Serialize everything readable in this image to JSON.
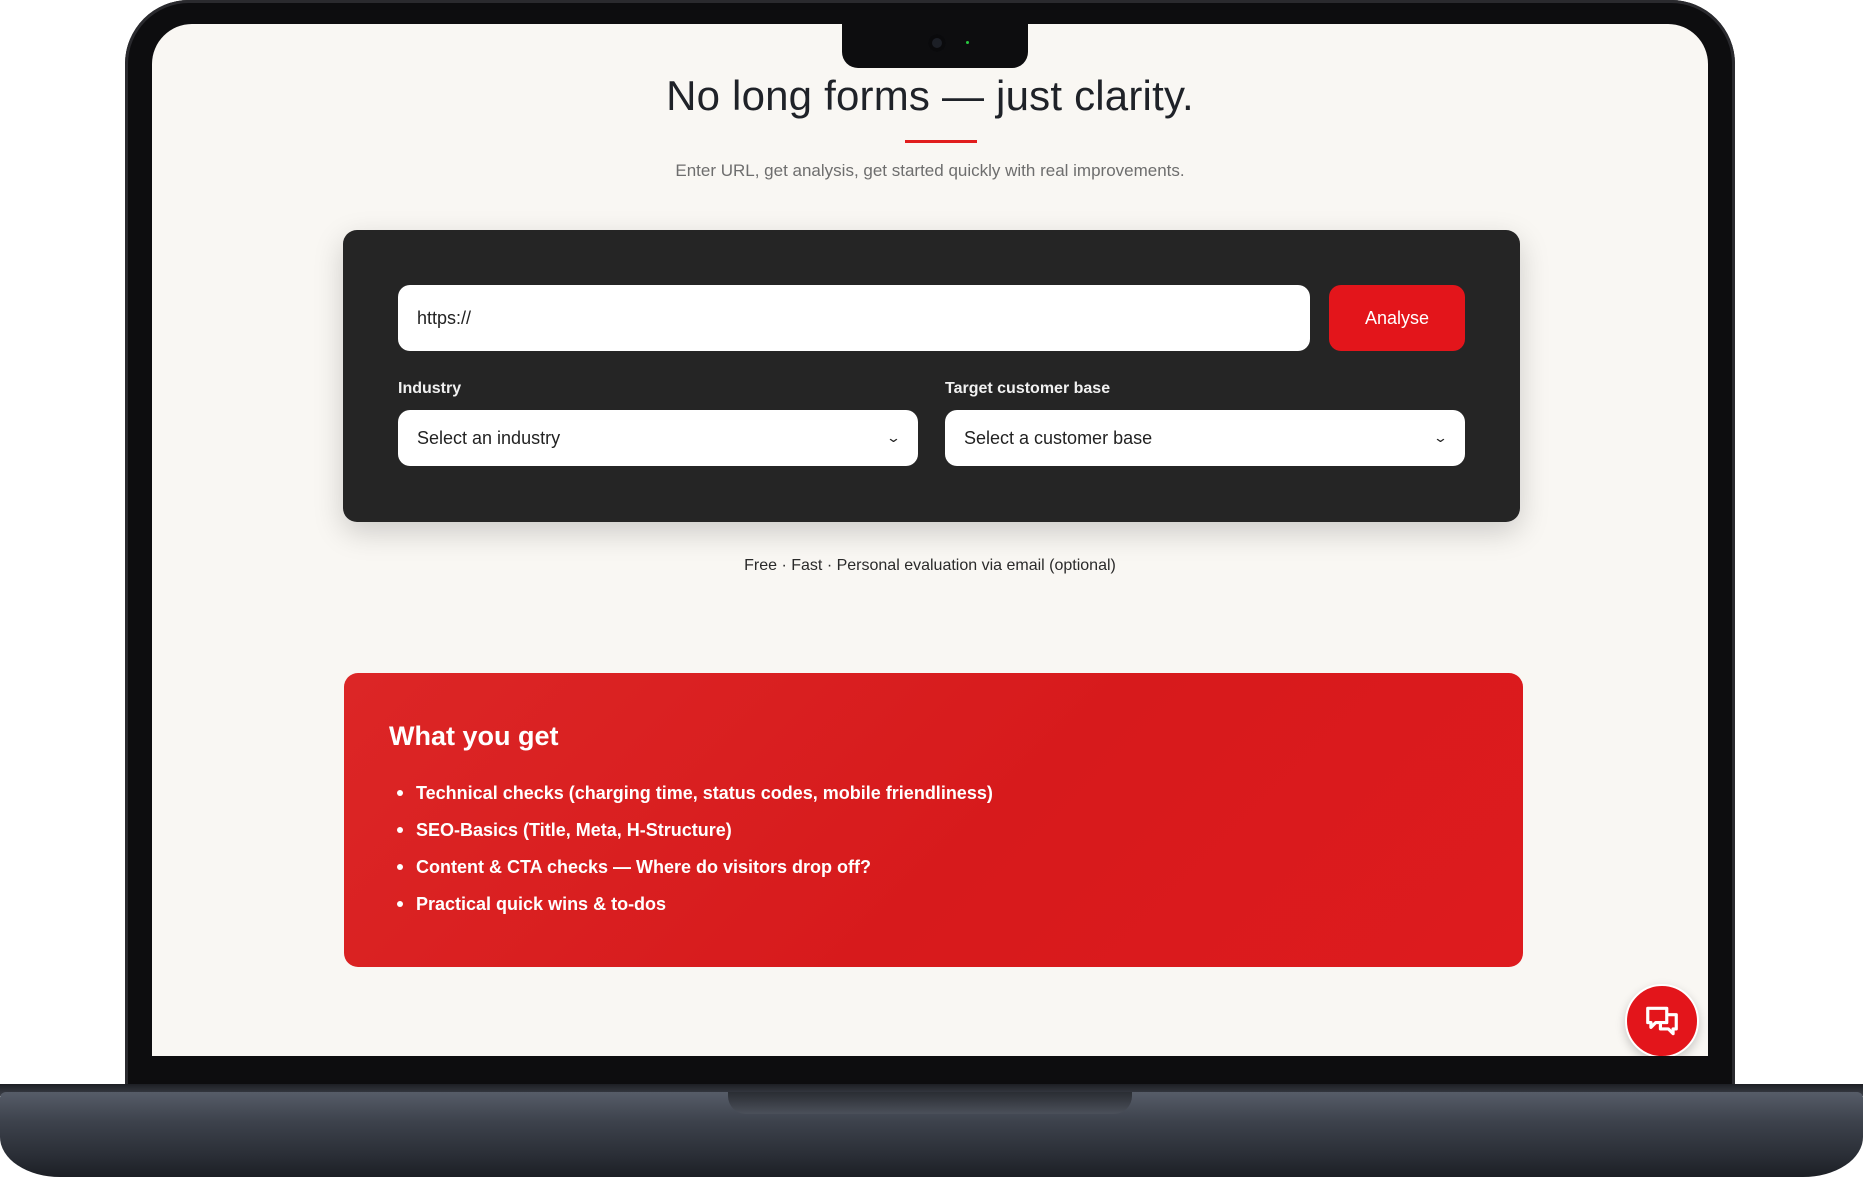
{
  "hero": {
    "title": "No long forms — just clarity.",
    "subtitle": "Enter URL, get analysis, get started quickly with real improvements."
  },
  "form": {
    "url_value": "https://",
    "analyse_label": "Analyse",
    "industry_label": "Industry",
    "industry_selected": "Select an industry",
    "customer_label": "Target customer base",
    "customer_selected": "Select a customer base"
  },
  "trust_line": "Free · Fast · Personal evaluation via email (optional)",
  "benefits": {
    "title": "What you get",
    "items": [
      "Technical checks (charging time, status codes, mobile friendliness)",
      "SEO-Basics (Title, Meta, H-Structure)",
      "Content & CTA checks — Where do visitors drop off?",
      "Practical quick wins & to-dos"
    ]
  },
  "colors": {
    "accent": "#e3151b",
    "card_dark": "#252525",
    "page_bg": "#f9f7f3"
  },
  "icons": {
    "chat": "chat-bubbles-icon",
    "dropdown": "chevron-down-icon"
  }
}
